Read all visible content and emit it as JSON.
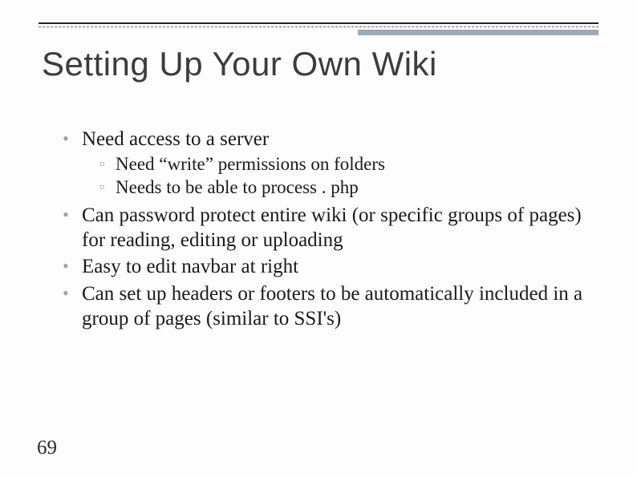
{
  "title": "Setting Up Your Own Wiki",
  "bullets": {
    "b0": "Need access to a server",
    "b0_sub": {
      "s0": "Need “write” permissions on folders",
      "s1": "Needs to be able to process . php"
    },
    "b1": "Can password protect entire wiki (or specific groups of pages) for reading, editing or uploading",
    "b2": "Easy to edit navbar at right",
    "b3": "Can set up headers or footers to be automatically included in a group of pages (similar to SSI's)"
  },
  "page_number": "69"
}
